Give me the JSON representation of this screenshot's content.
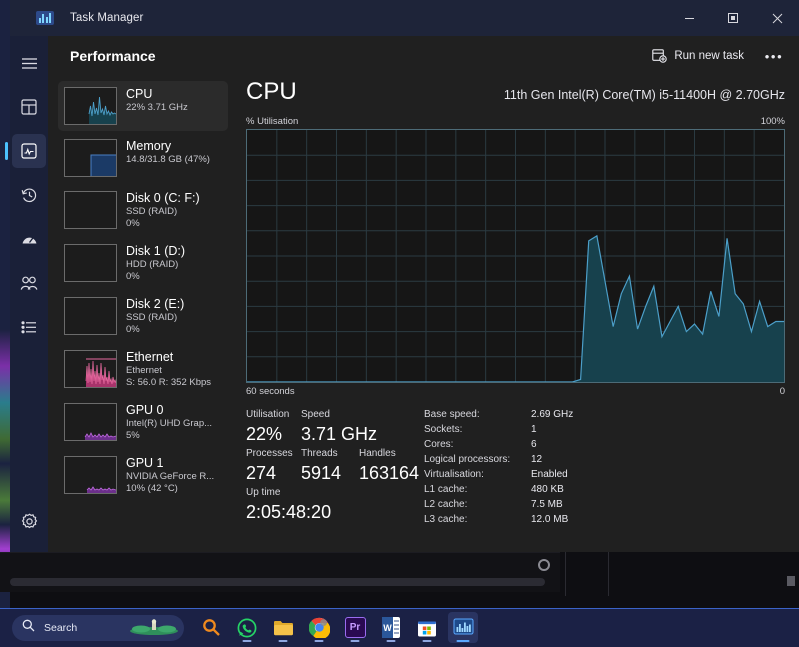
{
  "window": {
    "title": "Task Manager",
    "app_icon": "task-manager-icon",
    "controls": {
      "minimize": "minimize-icon",
      "maximize": "maximize-icon",
      "close": "close-icon"
    }
  },
  "nav_rail": {
    "items": [
      {
        "icon": "hamburger-menu-icon",
        "name": "menu",
        "selected": false
      },
      {
        "icon": "processes-icon",
        "name": "processes",
        "selected": false
      },
      {
        "icon": "performance-icon",
        "name": "performance",
        "selected": true
      },
      {
        "icon": "app-history-icon",
        "name": "app-history",
        "selected": false
      },
      {
        "icon": "startup-apps-icon",
        "name": "startup-apps",
        "selected": false
      },
      {
        "icon": "users-icon",
        "name": "users",
        "selected": false
      },
      {
        "icon": "details-icon",
        "name": "details",
        "selected": false
      },
      {
        "icon": "settings-gear-icon",
        "name": "settings",
        "selected": true
      }
    ]
  },
  "page": {
    "title": "Performance",
    "run_new_task": "Run new task",
    "run_new_task_icon": "run-new-task-icon",
    "more_options": "•••"
  },
  "sidebar": {
    "items": [
      {
        "name": "CPU",
        "sub1": "22% 3.71 GHz",
        "sub2": "",
        "selected": true,
        "graph": "cpu"
      },
      {
        "name": "Memory",
        "sub1": "14.8/31.8 GB (47%)",
        "sub2": "",
        "selected": false,
        "graph": "memory"
      },
      {
        "name": "Disk 0 (C: F:)",
        "sub1": "SSD (RAID)",
        "sub2": "0%",
        "selected": false,
        "graph": "flat"
      },
      {
        "name": "Disk 1 (D:)",
        "sub1": "HDD (RAID)",
        "sub2": "0%",
        "selected": false,
        "graph": "flat"
      },
      {
        "name": "Disk 2 (E:)",
        "sub1": "SSD (RAID)",
        "sub2": "0%",
        "selected": false,
        "graph": "flat"
      },
      {
        "name": "Ethernet",
        "sub1": "Ethernet",
        "sub2": "S: 56.0 R: 352 Kbps",
        "selected": false,
        "graph": "ethernet"
      },
      {
        "name": "GPU 0",
        "sub1": "Intel(R) UHD Grap...",
        "sub2": "5%",
        "selected": false,
        "graph": "gpu"
      },
      {
        "name": "GPU 1",
        "sub1": "NVIDIA GeForce R...",
        "sub2": "10%  (42 °C)",
        "selected": false,
        "graph": "gpu"
      }
    ]
  },
  "main": {
    "title": "CPU",
    "model": "11th Gen Intel(R) Core(TM) i5-11400H @ 2.70GHz",
    "axis_y_label": "% Utilisation",
    "axis_y_max": "100%",
    "axis_x_left": "60 seconds",
    "axis_x_right": "0",
    "stats": {
      "utilisation_label": "Utilisation",
      "utilisation_value": "22%",
      "speed_label": "Speed",
      "speed_value": "3.71 GHz",
      "processes_label": "Processes",
      "processes_value": "274",
      "threads_label": "Threads",
      "threads_value": "5914",
      "handles_label": "Handles",
      "handles_value": "163164",
      "uptime_label": "Up time",
      "uptime_value": "2:05:48:20"
    },
    "specs": [
      {
        "key": "Base speed:",
        "value": "2.69 GHz"
      },
      {
        "key": "Sockets:",
        "value": "1"
      },
      {
        "key": "Cores:",
        "value": "6"
      },
      {
        "key": "Logical processors:",
        "value": "12"
      },
      {
        "key": "Virtualisation:",
        "value": "Enabled"
      },
      {
        "key": "L1 cache:",
        "value": "480 KB"
      },
      {
        "key": "L2 cache:",
        "value": "7.5 MB"
      },
      {
        "key": "L3 cache:",
        "value": "12.0 MB"
      }
    ]
  },
  "chart_data": {
    "type": "area",
    "title": "CPU % Utilisation",
    "ylabel": "% Utilisation",
    "xlabel": "60 seconds",
    "ylim": [
      0,
      100
    ],
    "xlim": [
      60,
      0
    ],
    "grid": true,
    "line_color": "#4c9fc9",
    "fill_color": "#17414d",
    "values": [
      0,
      0,
      0,
      0,
      0,
      0,
      0,
      0,
      0,
      0,
      0,
      0,
      0,
      0,
      0,
      0,
      0,
      0,
      0,
      0,
      0,
      0,
      0,
      0,
      0,
      0,
      0,
      0,
      0,
      0,
      0,
      0,
      0,
      0,
      0,
      0,
      0,
      0,
      0,
      0,
      0,
      1,
      56,
      58,
      40,
      22,
      35,
      42,
      21,
      30,
      38,
      18,
      24,
      30,
      20,
      23,
      19,
      36,
      26,
      57,
      35,
      31,
      20,
      32,
      22,
      24,
      24
    ]
  },
  "taskbar": {
    "search_label": "Search",
    "search_icon": "search-icon",
    "items": [
      {
        "name": "widgets-search-icon",
        "label": ""
      },
      {
        "name": "whatsapp-icon",
        "label": ""
      },
      {
        "name": "file-explorer-icon",
        "label": ""
      },
      {
        "name": "chrome-icon",
        "label": ""
      },
      {
        "name": "premiere-pro-icon",
        "label": "Pr"
      },
      {
        "name": "word-icon",
        "label": "W"
      },
      {
        "name": "microsoft-store-icon",
        "label": ""
      },
      {
        "name": "task-manager-taskbar-icon",
        "label": ""
      }
    ]
  }
}
